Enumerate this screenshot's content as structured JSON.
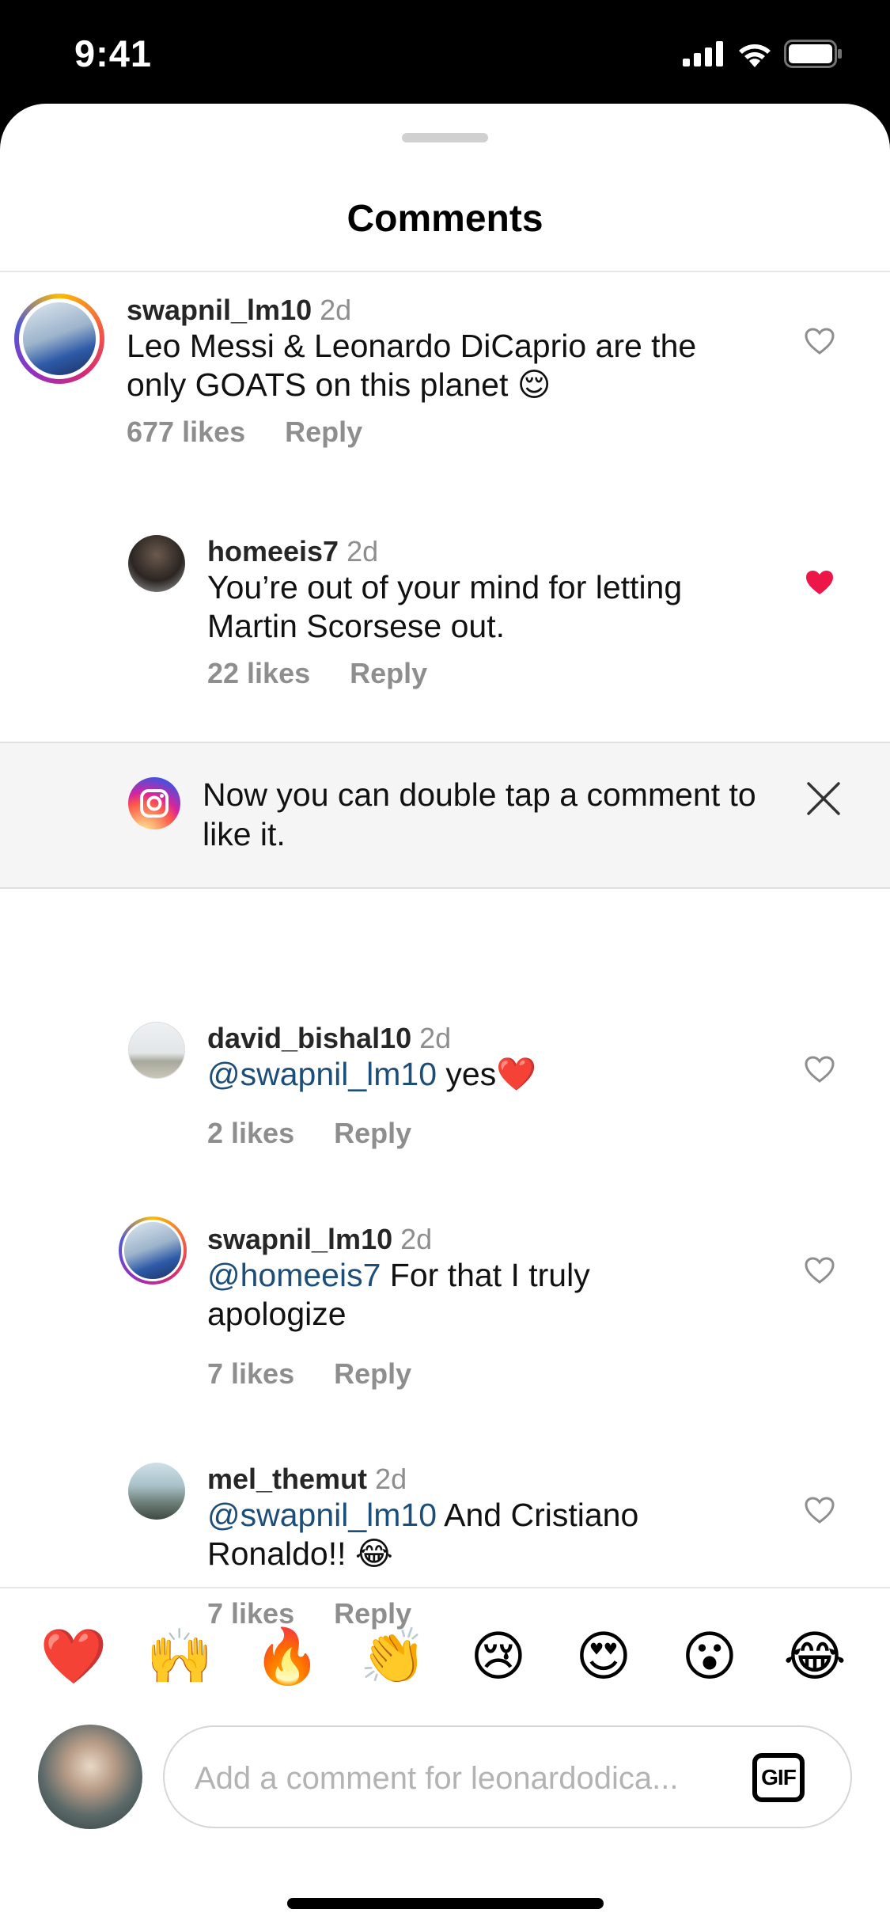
{
  "status_bar": {
    "time": "9:41"
  },
  "sheet": {
    "title": "Comments"
  },
  "comments": [
    {
      "user": "swapnil_lm10",
      "time": "2d",
      "text": "Leo Messi & Leonardo DiCaprio are the only GOATS on this planet 😌",
      "likes": "677 likes",
      "reply": "Reply",
      "liked": false
    },
    {
      "user": "homeeis7",
      "time": "2d",
      "text": "You’re out of your mind for letting Martin Scorsese out.",
      "likes": "22 likes",
      "reply": "Reply",
      "liked": true
    },
    {
      "user": "david_bishal10",
      "time": "2d",
      "mention": "@swapnil_lm10",
      "text": " yes❤️",
      "likes": "2 likes",
      "reply": "Reply",
      "liked": false
    },
    {
      "user": "swapnil_lm10",
      "time": "2d",
      "mention": "@homeeis7",
      "text": " For that I truly apologize",
      "likes": "7 likes",
      "reply": "Reply",
      "liked": false
    },
    {
      "user": "mel_themut",
      "time": "2d",
      "mention": "@swapnil_lm10",
      "text": " And Cristiano Ronaldo!! 😂",
      "likes": "7 likes",
      "reply": "Reply",
      "liked": false
    }
  ],
  "tip": {
    "text": "Now you can double tap a comment to like it."
  },
  "reactions": [
    "❤️",
    "🙌",
    "🔥",
    "👏",
    "😢",
    "😍",
    "😮",
    "😂"
  ],
  "composer": {
    "placeholder": "Add a comment for leonardodica...",
    "value": "",
    "gif_label": "GIF"
  },
  "colors": {
    "like_red": "#ed1649",
    "mention_blue": "#1d4e7a",
    "muted_gray": "#8e8e8e"
  }
}
